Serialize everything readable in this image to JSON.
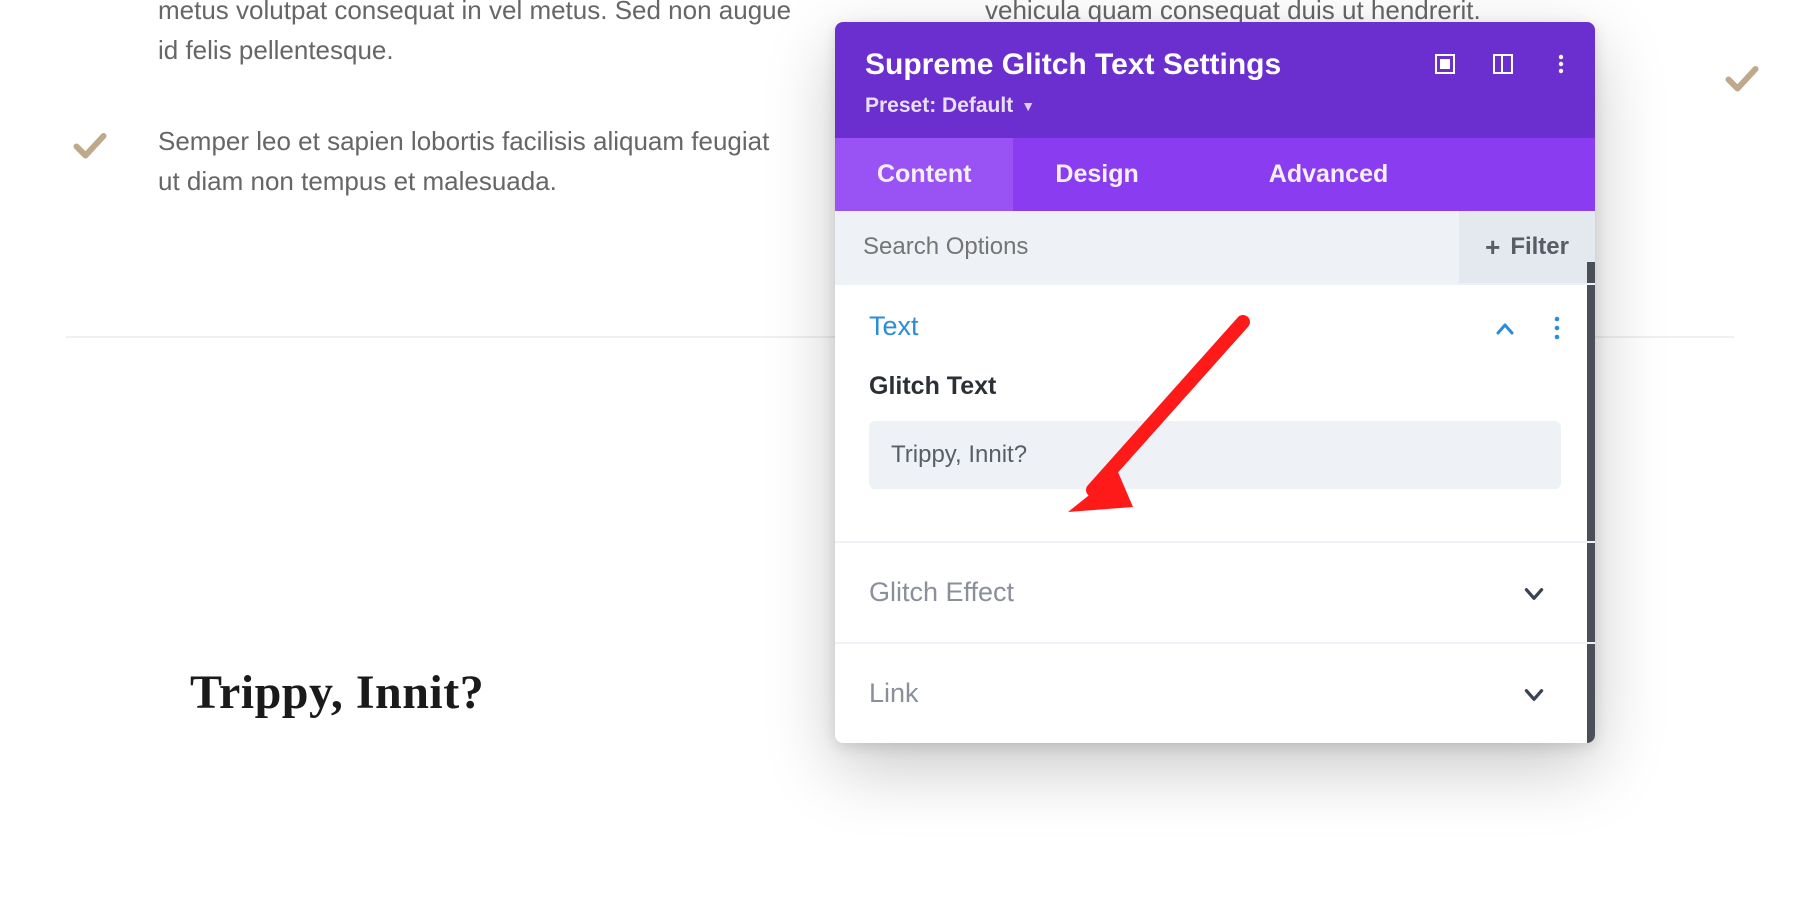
{
  "background": {
    "left_para": "metus volutpat consequat in vel metus. Sed non augue id felis pellentesque.",
    "left_bullet": "Semper leo et sapien lobortis facilisis aliquam feugiat ut diam non tempus et malesuada.",
    "right_para": "vehicula quam consequat duis ut hendrerit."
  },
  "preview": {
    "glitch_text": "Trippy, Innit?"
  },
  "panel": {
    "title": "Supreme Glitch Text Settings",
    "preset_label": "Preset: Default",
    "tabs": {
      "content": "Content",
      "design": "Design",
      "advanced": "Advanced"
    },
    "search_placeholder": "Search Options",
    "filter_label": "Filter",
    "sections": {
      "text": {
        "title": "Text",
        "field_label": "Glitch Text",
        "field_value": "Trippy, Innit?"
      },
      "glitch_effect": {
        "title": "Glitch Effect"
      },
      "link": {
        "title": "Link"
      }
    }
  }
}
